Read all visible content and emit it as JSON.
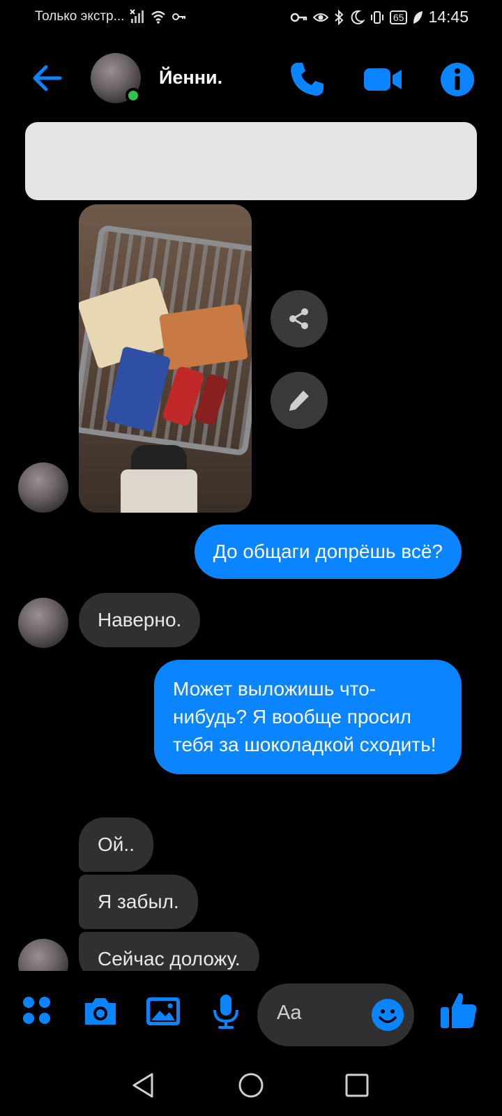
{
  "status_bar": {
    "carrier_text": "Только экстр...",
    "battery": "65",
    "time": "14:45"
  },
  "header": {
    "contact_name": "Йенни."
  },
  "messages": [
    {
      "side": "out",
      "text": "До общаги допрёшь всё?"
    },
    {
      "side": "in",
      "text": "Наверно."
    },
    {
      "side": "out",
      "text": "Может выложишь что-нибудь? Я вообще просил тебя за шоколадкой сходить!"
    },
    {
      "side": "in",
      "text": "Ой.."
    },
    {
      "side": "in",
      "text": "Я забыл."
    },
    {
      "side": "in",
      "text": "Сейчас доложу."
    }
  ],
  "composer": {
    "placeholder": "Aa"
  },
  "colors": {
    "accent": "#0a84ff",
    "incoming_bubble": "#303032",
    "online": "#31c44a"
  }
}
